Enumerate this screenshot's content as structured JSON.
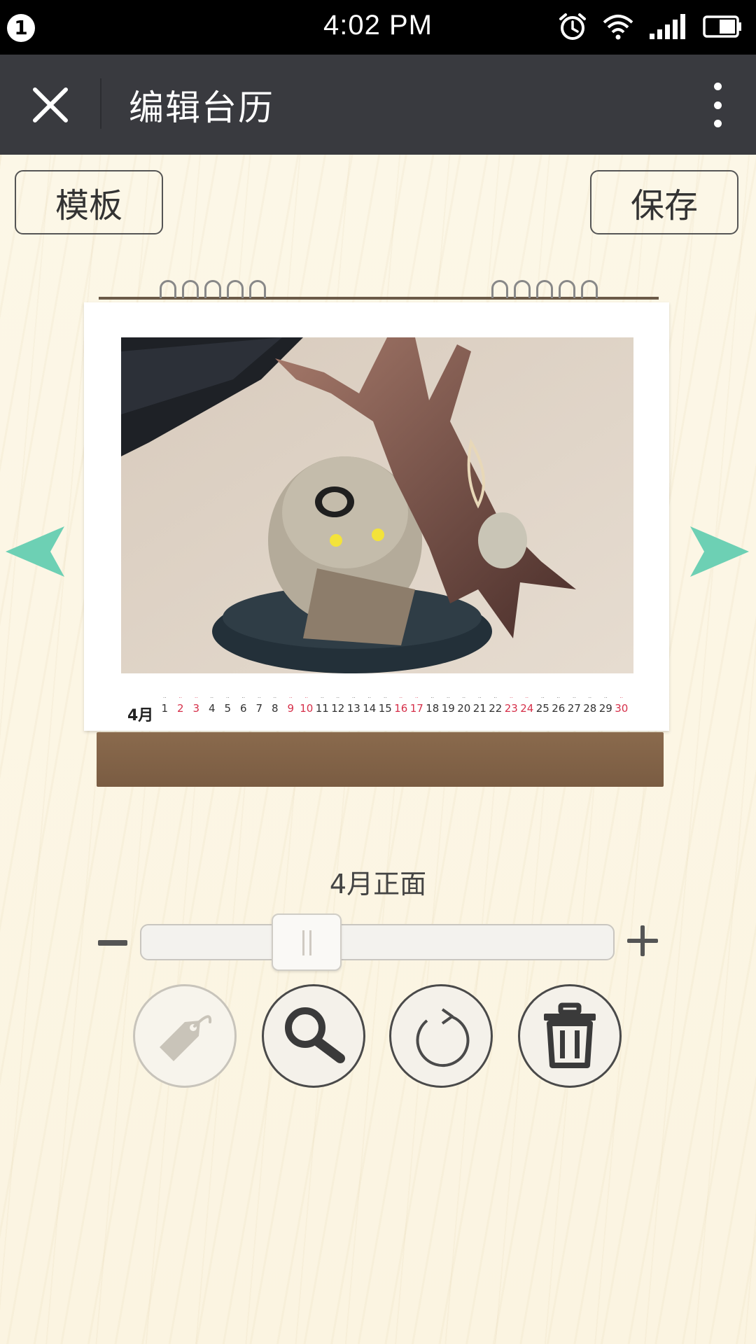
{
  "status_bar": {
    "notification_count": "1",
    "time": "4:02 PM",
    "icons": [
      "alarm-icon",
      "wifi-icon",
      "signal-icon",
      "battery-icon"
    ]
  },
  "title_bar": {
    "title": "编辑台历",
    "close_icon": "close-icon",
    "more_icon": "more-vertical-icon"
  },
  "toolbar": {
    "template_label": "模板",
    "save_label": "保存"
  },
  "calendar": {
    "month_label": "4月",
    "days": [
      {
        "num": "1",
        "red": false
      },
      {
        "num": "2",
        "red": true
      },
      {
        "num": "3",
        "red": true
      },
      {
        "num": "4",
        "red": false
      },
      {
        "num": "5",
        "red": false
      },
      {
        "num": "6",
        "red": false
      },
      {
        "num": "7",
        "red": false
      },
      {
        "num": "8",
        "red": false
      },
      {
        "num": "9",
        "red": true
      },
      {
        "num": "10",
        "red": true
      },
      {
        "num": "11",
        "red": false
      },
      {
        "num": "12",
        "red": false
      },
      {
        "num": "13",
        "red": false
      },
      {
        "num": "14",
        "red": false
      },
      {
        "num": "15",
        "red": false
      },
      {
        "num": "16",
        "red": true
      },
      {
        "num": "17",
        "red": true
      },
      {
        "num": "18",
        "red": false
      },
      {
        "num": "19",
        "red": false
      },
      {
        "num": "20",
        "red": false
      },
      {
        "num": "21",
        "red": false
      },
      {
        "num": "22",
        "red": false
      },
      {
        "num": "23",
        "red": true
      },
      {
        "num": "24",
        "red": true
      },
      {
        "num": "25",
        "red": false
      },
      {
        "num": "26",
        "red": false
      },
      {
        "num": "27",
        "red": false
      },
      {
        "num": "28",
        "red": false
      },
      {
        "num": "29",
        "red": false
      },
      {
        "num": "30",
        "red": true
      }
    ]
  },
  "navigation": {
    "prev_icon": "arrow-left-icon",
    "next_icon": "arrow-right-icon",
    "arrow_color": "#6dd0b4"
  },
  "page_caption": "4月正面",
  "zoom": {
    "minus_icon": "minus-icon",
    "plus_icon": "plus-icon",
    "level": 0.3
  },
  "tools": [
    {
      "name": "tag-icon",
      "enabled": false
    },
    {
      "name": "search-icon",
      "enabled": true
    },
    {
      "name": "rotate-icon",
      "enabled": true
    },
    {
      "name": "trash-icon",
      "enabled": true
    }
  ],
  "colors": {
    "title_bar": "#393a3f",
    "status_bar": "#000000",
    "background": "#fbf6e6",
    "weekend_red": "#d6304a"
  }
}
